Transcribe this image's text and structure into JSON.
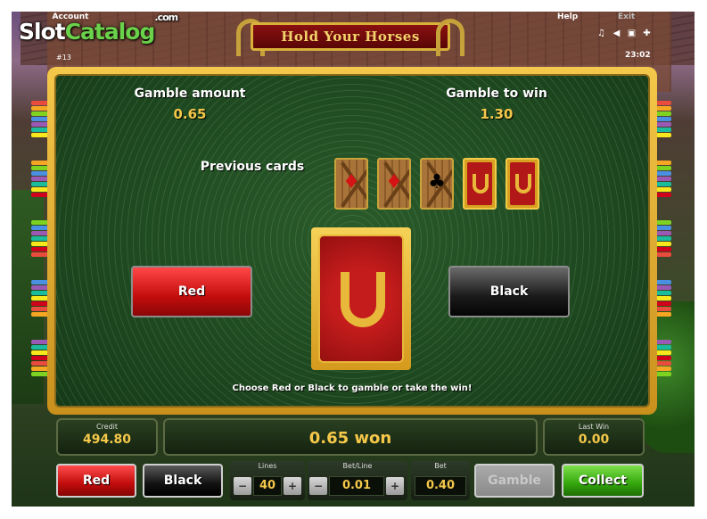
{
  "header": {
    "watermark": {
      "part1": "Slot",
      "part2": "Catalog",
      "suffix": ".com"
    },
    "account": "Account",
    "round": "#13",
    "help": "Help",
    "exit": "Exit",
    "clock": "23:02",
    "icons": [
      "music-note-icon",
      "speaker-icon",
      "fullscreen-icon",
      "settings-icon"
    ]
  },
  "logo": {
    "title": "Hold Your Horses"
  },
  "gamble": {
    "amount_label": "Gamble amount",
    "amount_value": "0.65",
    "to_win_label": "Gamble to win",
    "to_win_value": "1.30",
    "previous_label": "Previous cards",
    "previous_cards": [
      {
        "type": "diamond",
        "color": "#d41414",
        "pip": "♦"
      },
      {
        "type": "diamond",
        "color": "#d41414",
        "pip": "♦"
      },
      {
        "type": "club",
        "color": "#000000",
        "pip": "♣"
      },
      {
        "type": "back"
      },
      {
        "type": "back"
      }
    ],
    "red_button": "Red",
    "black_button": "Black",
    "instruction": "Choose Red or Black to gamble or take the win!"
  },
  "status": {
    "credit_label": "Credit",
    "credit_value": "494.80",
    "message": "0.65 won",
    "last_win_label": "Last Win",
    "last_win_value": "0.00"
  },
  "controls": {
    "red_label": "Red",
    "black_label": "Black",
    "lines_label": "Lines",
    "lines_value": "40",
    "bet_line_label": "Bet/Line",
    "bet_line_value": "0.01",
    "bet_label": "Bet",
    "bet_value": "0.40",
    "minus": "−",
    "plus": "+",
    "gamble_label": "Gamble",
    "collect_label": "Collect"
  },
  "colors": {
    "accent_gold": "#f5c84a",
    "felt_green": "#1f4a21",
    "red": "#c40d0d",
    "collect_green": "#34a60c"
  }
}
